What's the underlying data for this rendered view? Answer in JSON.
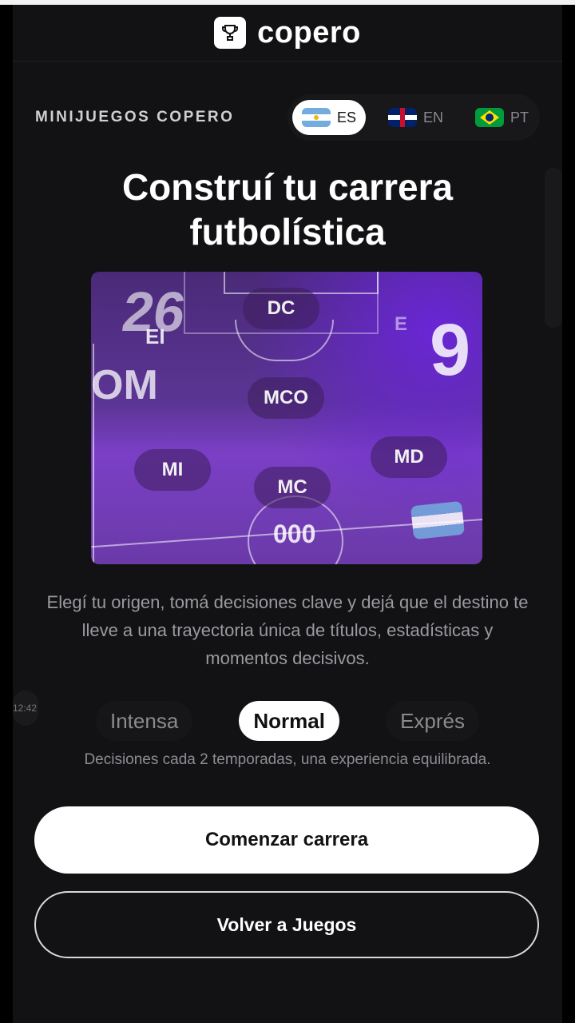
{
  "header": {
    "logo_text": "copero",
    "logo_icon": "trophy-icon"
  },
  "section_label": "MINIJUEGOS COPERO",
  "languages": [
    {
      "code": "ES",
      "flag": "argentina-flag-icon",
      "active": true
    },
    {
      "code": "EN",
      "flag": "uk-flag-icon",
      "active": false
    },
    {
      "code": "PT",
      "flag": "brazil-flag-icon",
      "active": false
    }
  ],
  "title_line1": "Construí tu carrera",
  "title_line2": "futbolística",
  "pitch": {
    "positions": [
      "DC",
      "MCO",
      "MI",
      "MC",
      "MD"
    ],
    "big_number_left": "26",
    "label_ei": "EI",
    "label_e": "E",
    "label_om": "OM",
    "big_number_right": "9",
    "badge_number": "000"
  },
  "description": "Elegí tu origen, tomá decisiones clave y dejá que el destino te lleve a una trayectoria única de títulos, estadísticas y momentos decisivos.",
  "time_badge": "12:42",
  "modes": [
    {
      "label": "Intensa",
      "active": false
    },
    {
      "label": "Normal",
      "active": true
    },
    {
      "label": "Exprés",
      "active": false
    }
  ],
  "mode_description": "Decisiones cada 2 temporadas, una experiencia equilibrada.",
  "buttons": {
    "start": "Comenzar carrera",
    "back": "Volver a Juegos"
  }
}
